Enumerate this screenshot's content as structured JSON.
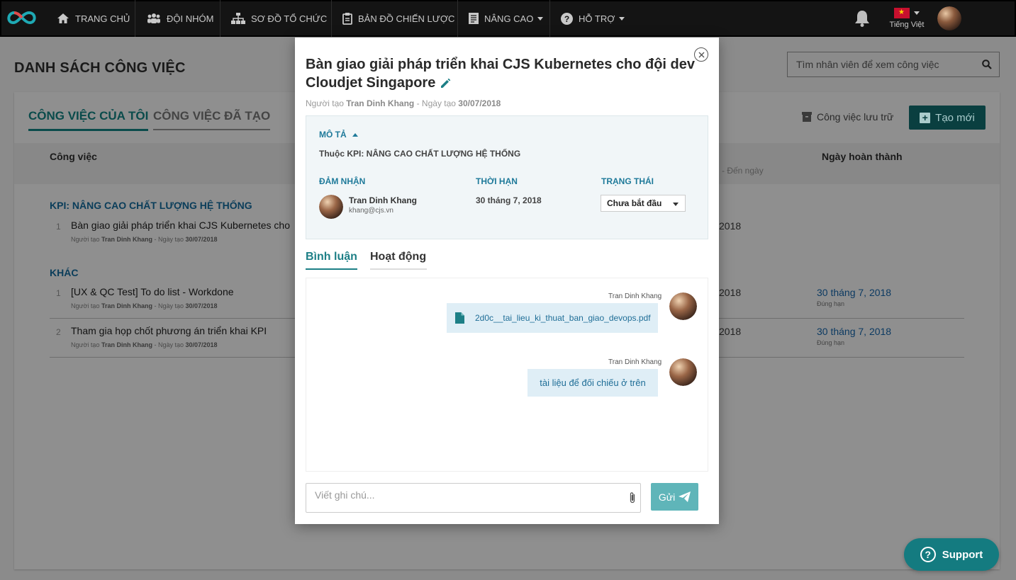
{
  "nav": {
    "items": [
      {
        "label": "TRANG CHỦ",
        "icon": "home-icon"
      },
      {
        "label": "ĐỘI NHÓM",
        "icon": "team-icon"
      },
      {
        "label": "SƠ ĐỒ TỔ CHỨC",
        "icon": "org-chart-icon"
      },
      {
        "label": "BẢN ĐỒ CHIẾN LƯỢC",
        "icon": "strategy-map-icon"
      },
      {
        "label": "NÂNG CAO",
        "icon": "document-icon"
      },
      {
        "label": "HỖ TRỢ",
        "icon": "help-icon"
      }
    ],
    "language": "Tiếng Việt"
  },
  "page": {
    "title": "DANH SÁCH CÔNG VIỆC",
    "search_placeholder": "Tìm nhân viên để xem công việc",
    "tabs": {
      "mine": "CÔNG VIỆC CỦA TÔI",
      "created": "CÔNG VIỆC ĐÃ TẠO"
    },
    "archive_label": "Công việc lưu trữ",
    "create_label": "Tạo mới",
    "columns": {
      "task": "Công việc",
      "done_date": "Ngày hoàn thành",
      "to_date": "- Đến ngày"
    },
    "groups": [
      {
        "title": "KPI: NÂNG CAO CHẤT LƯỢNG HỆ THỐNG"
      },
      {
        "title": "KHÁC"
      }
    ],
    "rows": [
      {
        "num": "1",
        "name": "Bàn giao giải pháp triển khai CJS Kubernetes cho",
        "meta_prefix": "Người tạo ",
        "creator": "Tran Dinh Khang",
        "meta_mid": " - Ngày tạo ",
        "created": "30/07/2018",
        "date_frag": "2018",
        "done": "",
        "done_sub": ""
      },
      {
        "num": "1",
        "name": "[UX & QC Test] To do list - Workdone",
        "meta_prefix": "Người tạo ",
        "creator": "Tran Dinh Khang",
        "meta_mid": " - Ngày tạo ",
        "created": "30/07/2018",
        "date_frag": "2018",
        "done": "30 tháng 7, 2018",
        "done_sub": "Đúng hạn"
      },
      {
        "num": "2",
        "name": "Tham gia họp chốt phương án triển khai KPI",
        "meta_prefix": "Người tạo ",
        "creator": "Tran Dinh Khang",
        "meta_mid": " - Ngày tạo ",
        "created": "30/07/2018",
        "date_frag": "2018",
        "done": "30 tháng 7, 2018",
        "done_sub": "Đúng hạn"
      }
    ]
  },
  "modal": {
    "title": "Bàn giao giải pháp triển khai CJS Kubernetes cho đội dev Cloudjet Singapore",
    "meta_prefix": "Người tạo ",
    "creator": "Tran Dinh Khang",
    "meta_mid": " - Ngày tạo ",
    "created": "30/07/2018",
    "desc_label": "MÔ TẢ",
    "kpi": "Thuộc KPI: NÂNG CAO CHẤT LƯỢNG HỆ THỐNG",
    "assignee_label": "ĐẢM NHẬN",
    "deadline_label": "THỜI HẠN",
    "status_label": "TRẠNG THÁI",
    "assignee_name": "Tran Dinh Khang",
    "assignee_email": "khang@cjs.vn",
    "deadline": "30 tháng 7, 2018",
    "status": "Chưa bắt đầu",
    "tabs": {
      "comment": "Bình luận",
      "activity": "Hoạt động"
    },
    "comments": [
      {
        "author": "Tran Dinh Khang",
        "text": "2d0c__tai_lieu_ki_thuat_ban_giao_devops.pdf",
        "is_file": true
      },
      {
        "author": "Tran Dinh Khang",
        "text": "tài liệu để đối chiếu ở trên",
        "is_file": false
      }
    ],
    "note_placeholder": "Viết ghi chú...",
    "send_label": "Gửi"
  },
  "support_label": "Support",
  "colors": {
    "accent": "#1d7f86",
    "nav_bg": "#141414",
    "bubble": "#dfeef6"
  }
}
